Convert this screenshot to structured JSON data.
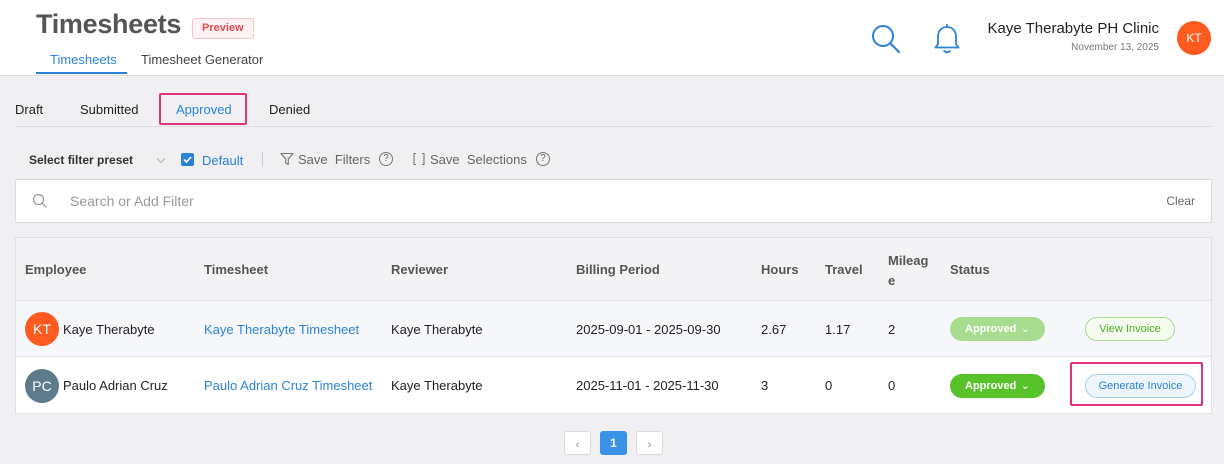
{
  "header": {
    "title": "Timesheets",
    "badge": "Preview",
    "tabs": [
      {
        "label": "Timesheets",
        "active": true
      },
      {
        "label": "Timesheet Generator",
        "active": false
      }
    ],
    "user": {
      "name": "Kaye Therabyte PH Clinic",
      "date": "November 13, 2025",
      "initials": "KT",
      "avatar_color": "#ff5a1f"
    },
    "icons": [
      "search-icon",
      "bell-icon"
    ]
  },
  "status_tabs": [
    {
      "label": "Draft",
      "active": false
    },
    {
      "label": "Submitted",
      "active": false
    },
    {
      "label": "Approved",
      "active": true
    },
    {
      "label": "Denied",
      "active": false
    }
  ],
  "filter_bar": {
    "preset_label": "Select filter preset",
    "default_label": "Default",
    "default_checked": true,
    "save_filters_label": "Save  Filters",
    "save_selections_label": "Save  Selections"
  },
  "search": {
    "placeholder": "Search or Add Filter",
    "clear_label": "Clear"
  },
  "table": {
    "columns": [
      "Employee",
      "Timesheet",
      "Reviewer",
      "Billing Period",
      "Hours",
      "Travel",
      "Mileag\ne",
      "Status"
    ],
    "rows": [
      {
        "initials": "KT",
        "avatar_color": "#ff5a1f",
        "employee": "Kaye Therabyte",
        "timesheet": "Kaye Therabyte Timesheet",
        "reviewer": "Kaye Therabyte",
        "billing_period": "2025-09-01 - 2025-09-30",
        "hours": "2.67",
        "travel": "1.17",
        "mileage": "2",
        "status": "Approved",
        "status_color": "#a8dc8e",
        "action": "View Invoice"
      },
      {
        "initials": "PC",
        "avatar_color": "#5e7b8c",
        "employee": "Paulo Adrian Cruz",
        "timesheet": "Paulo Adrian Cruz Timesheet",
        "reviewer": "Kaye Therabyte",
        "billing_period": "2025-11-01 - 2025-11-30",
        "hours": "3",
        "travel": "0",
        "mileage": "0",
        "status": "Approved",
        "status_color": "#57c22a",
        "action": "Generate Invoice"
      }
    ]
  },
  "pagination": {
    "prev": "‹",
    "current": "1",
    "next": "›"
  },
  "colors": {
    "accent": "#2b82d9",
    "highlight": "#e0347a"
  }
}
